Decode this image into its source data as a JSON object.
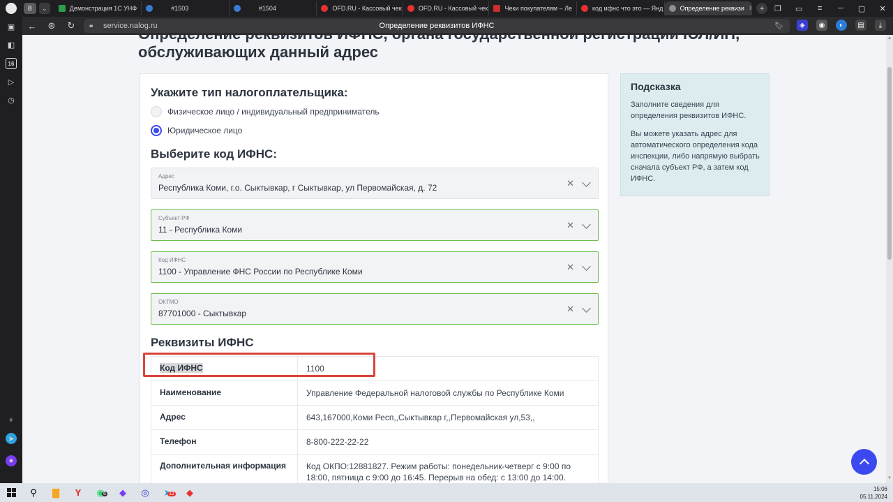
{
  "browser": {
    "tab_count": "8",
    "tabs": [
      {
        "label": "Демонстрация 1С УНФ",
        "color": "#2e9d4a"
      },
      {
        "label": "#1503",
        "color": "#3a7bd5"
      },
      {
        "label": "#1504",
        "color": "#3a7bd5"
      },
      {
        "label": "OFD.RU - Кассовый чек",
        "color": "#e8322f"
      },
      {
        "label": "OFD.RU - Кассовый чек",
        "color": "#e8322f"
      },
      {
        "label": "Чеки покупателям – Ле",
        "color": "#c9302c"
      },
      {
        "label": "код ифнс что это — Янд",
        "color": "#e8322f"
      },
      {
        "label": "Определение реквизи",
        "color": "#8a8f98"
      }
    ],
    "url": "service.nalog.ru",
    "page_title": "Определение реквизитов ИФНС",
    "sidebar_badge": "16"
  },
  "page": {
    "heading": "Определение реквизитов ИФНС, органа государственной регистрации ЮЛ/ИП, обслуживающих данный адрес",
    "taxpayer_title": "Укажите тип налогоплательщика:",
    "radio_options": [
      {
        "label": "Физическое лицо / индивидуальный предприниматель",
        "checked": false
      },
      {
        "label": "Юридическое лицо",
        "checked": true
      }
    ],
    "ifns_title": "Выберите код ИФНС:",
    "fields": {
      "address": {
        "label": "Адрес",
        "value": "Республика Коми, г.о. Сыктывкар, г Сыктывкар, ул Первомайская, д. 72"
      },
      "subject": {
        "label": "Субъект РФ",
        "value": "11 - Республика Коми"
      },
      "ifns_code": {
        "label": "Код ИФНС",
        "value": "1100 - Управление ФНС России по Республике Коми"
      },
      "oktmo": {
        "label": "ОКТМО",
        "value": "87701000 - Сыктывкар"
      }
    },
    "requisites_title": "Реквизиты ИФНС",
    "requisites": [
      {
        "key": "Код ИФНС",
        "value": "1100"
      },
      {
        "key": "Наименование",
        "value": "Управление Федеральной налоговой службы по Республике Коми"
      },
      {
        "key": "Адрес",
        "value": "643,167000,Коми Респ,,Сыктывкар г,,Первомайская ул,53,,"
      },
      {
        "key": "Телефон",
        "value": "8-800-222-22-22"
      },
      {
        "key": "Дополнительная информация",
        "value": "Код ОКПО:12881827. Режим работы: понедельник-четверг с 9:00 по 18:00, пятница с 9:00 до 16:45. Перерыв на обед: с 13:00 до 14:00. Выходной: суббота, воскресенье."
      }
    ],
    "hint": {
      "title": "Подсказка",
      "p1": "Заполните сведения для определения реквизитов ИФНС.",
      "p2": "Вы можете указать адрес для автоматического определения кода инспекции, либо напрямую выбрать сначала субъект РФ, а затем код ИФНС."
    },
    "accent_color": "#3c49f0",
    "highlight_color": "#d9463b"
  },
  "taskbar": {
    "whatsapp_badge": "6",
    "telegram_badge": "12",
    "time": "15:06",
    "date": "05.11.2024"
  }
}
